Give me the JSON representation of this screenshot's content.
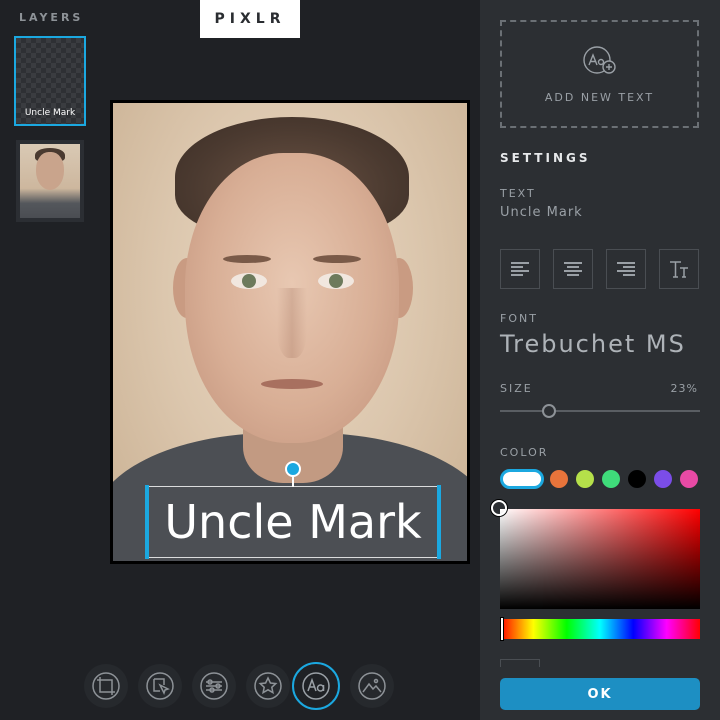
{
  "app": {
    "logo": "PIXLR"
  },
  "layers": {
    "title": "LAYERS",
    "items": [
      {
        "label": "Uncle Mark",
        "type": "text",
        "active": true
      },
      {
        "label": "",
        "type": "photo",
        "active": false
      }
    ]
  },
  "canvas": {
    "text": "Uncle Mark"
  },
  "toolbar": {
    "tools": [
      {
        "icon": "crop-icon",
        "active": false
      },
      {
        "icon": "adjust-cursor-icon",
        "active": false
      },
      {
        "icon": "sliders-icon",
        "active": false
      },
      {
        "icon": "sticker-star-icon",
        "active": false
      },
      {
        "icon": "text-aa-icon",
        "active": true
      },
      {
        "icon": "image-mountain-icon",
        "active": false
      }
    ]
  },
  "panel": {
    "add_text_label": "ADD NEW TEXT",
    "settings_title": "SETTINGS",
    "text_label": "TEXT",
    "text_value": "Uncle Mark",
    "font_label": "FONT",
    "font_value": "Trebuchet MS",
    "size_label": "SIZE",
    "size_value": "23%",
    "size_percent": 23,
    "color_label": "COLOR",
    "swatches": [
      "#ffffff",
      "#e8743b",
      "#b5e04a",
      "#3fdc7a",
      "#000000",
      "#7b4de8",
      "#e84aa5"
    ],
    "selected_color": "#ffffff",
    "ok_label": "OK"
  },
  "colors": {
    "accent": "#1ba8e0",
    "ok_button": "#1d8fc3",
    "panel_bg": "#2c2f33",
    "app_bg": "#1f2125"
  }
}
